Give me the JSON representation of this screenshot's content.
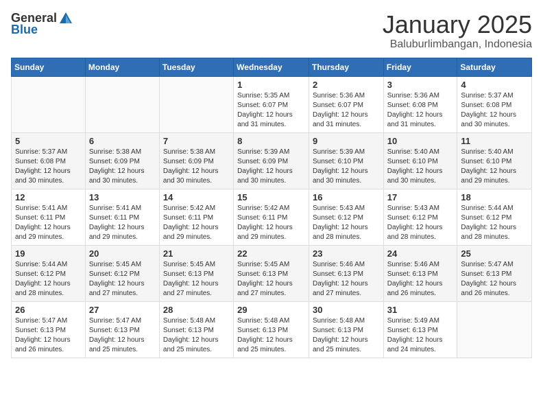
{
  "header": {
    "logo_general": "General",
    "logo_blue": "Blue",
    "title": "January 2025",
    "subtitle": "Baluburlimbangan, Indonesia"
  },
  "calendar": {
    "days_of_week": [
      "Sunday",
      "Monday",
      "Tuesday",
      "Wednesday",
      "Thursday",
      "Friday",
      "Saturday"
    ],
    "weeks": [
      [
        {
          "day": "",
          "content": ""
        },
        {
          "day": "",
          "content": ""
        },
        {
          "day": "",
          "content": ""
        },
        {
          "day": "1",
          "content": "Sunrise: 5:35 AM\nSunset: 6:07 PM\nDaylight: 12 hours\nand 31 minutes."
        },
        {
          "day": "2",
          "content": "Sunrise: 5:36 AM\nSunset: 6:07 PM\nDaylight: 12 hours\nand 31 minutes."
        },
        {
          "day": "3",
          "content": "Sunrise: 5:36 AM\nSunset: 6:08 PM\nDaylight: 12 hours\nand 31 minutes."
        },
        {
          "day": "4",
          "content": "Sunrise: 5:37 AM\nSunset: 6:08 PM\nDaylight: 12 hours\nand 30 minutes."
        }
      ],
      [
        {
          "day": "5",
          "content": "Sunrise: 5:37 AM\nSunset: 6:08 PM\nDaylight: 12 hours\nand 30 minutes."
        },
        {
          "day": "6",
          "content": "Sunrise: 5:38 AM\nSunset: 6:09 PM\nDaylight: 12 hours\nand 30 minutes."
        },
        {
          "day": "7",
          "content": "Sunrise: 5:38 AM\nSunset: 6:09 PM\nDaylight: 12 hours\nand 30 minutes."
        },
        {
          "day": "8",
          "content": "Sunrise: 5:39 AM\nSunset: 6:09 PM\nDaylight: 12 hours\nand 30 minutes."
        },
        {
          "day": "9",
          "content": "Sunrise: 5:39 AM\nSunset: 6:10 PM\nDaylight: 12 hours\nand 30 minutes."
        },
        {
          "day": "10",
          "content": "Sunrise: 5:40 AM\nSunset: 6:10 PM\nDaylight: 12 hours\nand 30 minutes."
        },
        {
          "day": "11",
          "content": "Sunrise: 5:40 AM\nSunset: 6:10 PM\nDaylight: 12 hours\nand 29 minutes."
        }
      ],
      [
        {
          "day": "12",
          "content": "Sunrise: 5:41 AM\nSunset: 6:11 PM\nDaylight: 12 hours\nand 29 minutes."
        },
        {
          "day": "13",
          "content": "Sunrise: 5:41 AM\nSunset: 6:11 PM\nDaylight: 12 hours\nand 29 minutes."
        },
        {
          "day": "14",
          "content": "Sunrise: 5:42 AM\nSunset: 6:11 PM\nDaylight: 12 hours\nand 29 minutes."
        },
        {
          "day": "15",
          "content": "Sunrise: 5:42 AM\nSunset: 6:11 PM\nDaylight: 12 hours\nand 29 minutes."
        },
        {
          "day": "16",
          "content": "Sunrise: 5:43 AM\nSunset: 6:12 PM\nDaylight: 12 hours\nand 28 minutes."
        },
        {
          "day": "17",
          "content": "Sunrise: 5:43 AM\nSunset: 6:12 PM\nDaylight: 12 hours\nand 28 minutes."
        },
        {
          "day": "18",
          "content": "Sunrise: 5:44 AM\nSunset: 6:12 PM\nDaylight: 12 hours\nand 28 minutes."
        }
      ],
      [
        {
          "day": "19",
          "content": "Sunrise: 5:44 AM\nSunset: 6:12 PM\nDaylight: 12 hours\nand 28 minutes."
        },
        {
          "day": "20",
          "content": "Sunrise: 5:45 AM\nSunset: 6:12 PM\nDaylight: 12 hours\nand 27 minutes."
        },
        {
          "day": "21",
          "content": "Sunrise: 5:45 AM\nSunset: 6:13 PM\nDaylight: 12 hours\nand 27 minutes."
        },
        {
          "day": "22",
          "content": "Sunrise: 5:45 AM\nSunset: 6:13 PM\nDaylight: 12 hours\nand 27 minutes."
        },
        {
          "day": "23",
          "content": "Sunrise: 5:46 AM\nSunset: 6:13 PM\nDaylight: 12 hours\nand 27 minutes."
        },
        {
          "day": "24",
          "content": "Sunrise: 5:46 AM\nSunset: 6:13 PM\nDaylight: 12 hours\nand 26 minutes."
        },
        {
          "day": "25",
          "content": "Sunrise: 5:47 AM\nSunset: 6:13 PM\nDaylight: 12 hours\nand 26 minutes."
        }
      ],
      [
        {
          "day": "26",
          "content": "Sunrise: 5:47 AM\nSunset: 6:13 PM\nDaylight: 12 hours\nand 26 minutes."
        },
        {
          "day": "27",
          "content": "Sunrise: 5:47 AM\nSunset: 6:13 PM\nDaylight: 12 hours\nand 25 minutes."
        },
        {
          "day": "28",
          "content": "Sunrise: 5:48 AM\nSunset: 6:13 PM\nDaylight: 12 hours\nand 25 minutes."
        },
        {
          "day": "29",
          "content": "Sunrise: 5:48 AM\nSunset: 6:13 PM\nDaylight: 12 hours\nand 25 minutes."
        },
        {
          "day": "30",
          "content": "Sunrise: 5:48 AM\nSunset: 6:13 PM\nDaylight: 12 hours\nand 25 minutes."
        },
        {
          "day": "31",
          "content": "Sunrise: 5:49 AM\nSunset: 6:13 PM\nDaylight: 12 hours\nand 24 minutes."
        },
        {
          "day": "",
          "content": ""
        }
      ]
    ]
  }
}
